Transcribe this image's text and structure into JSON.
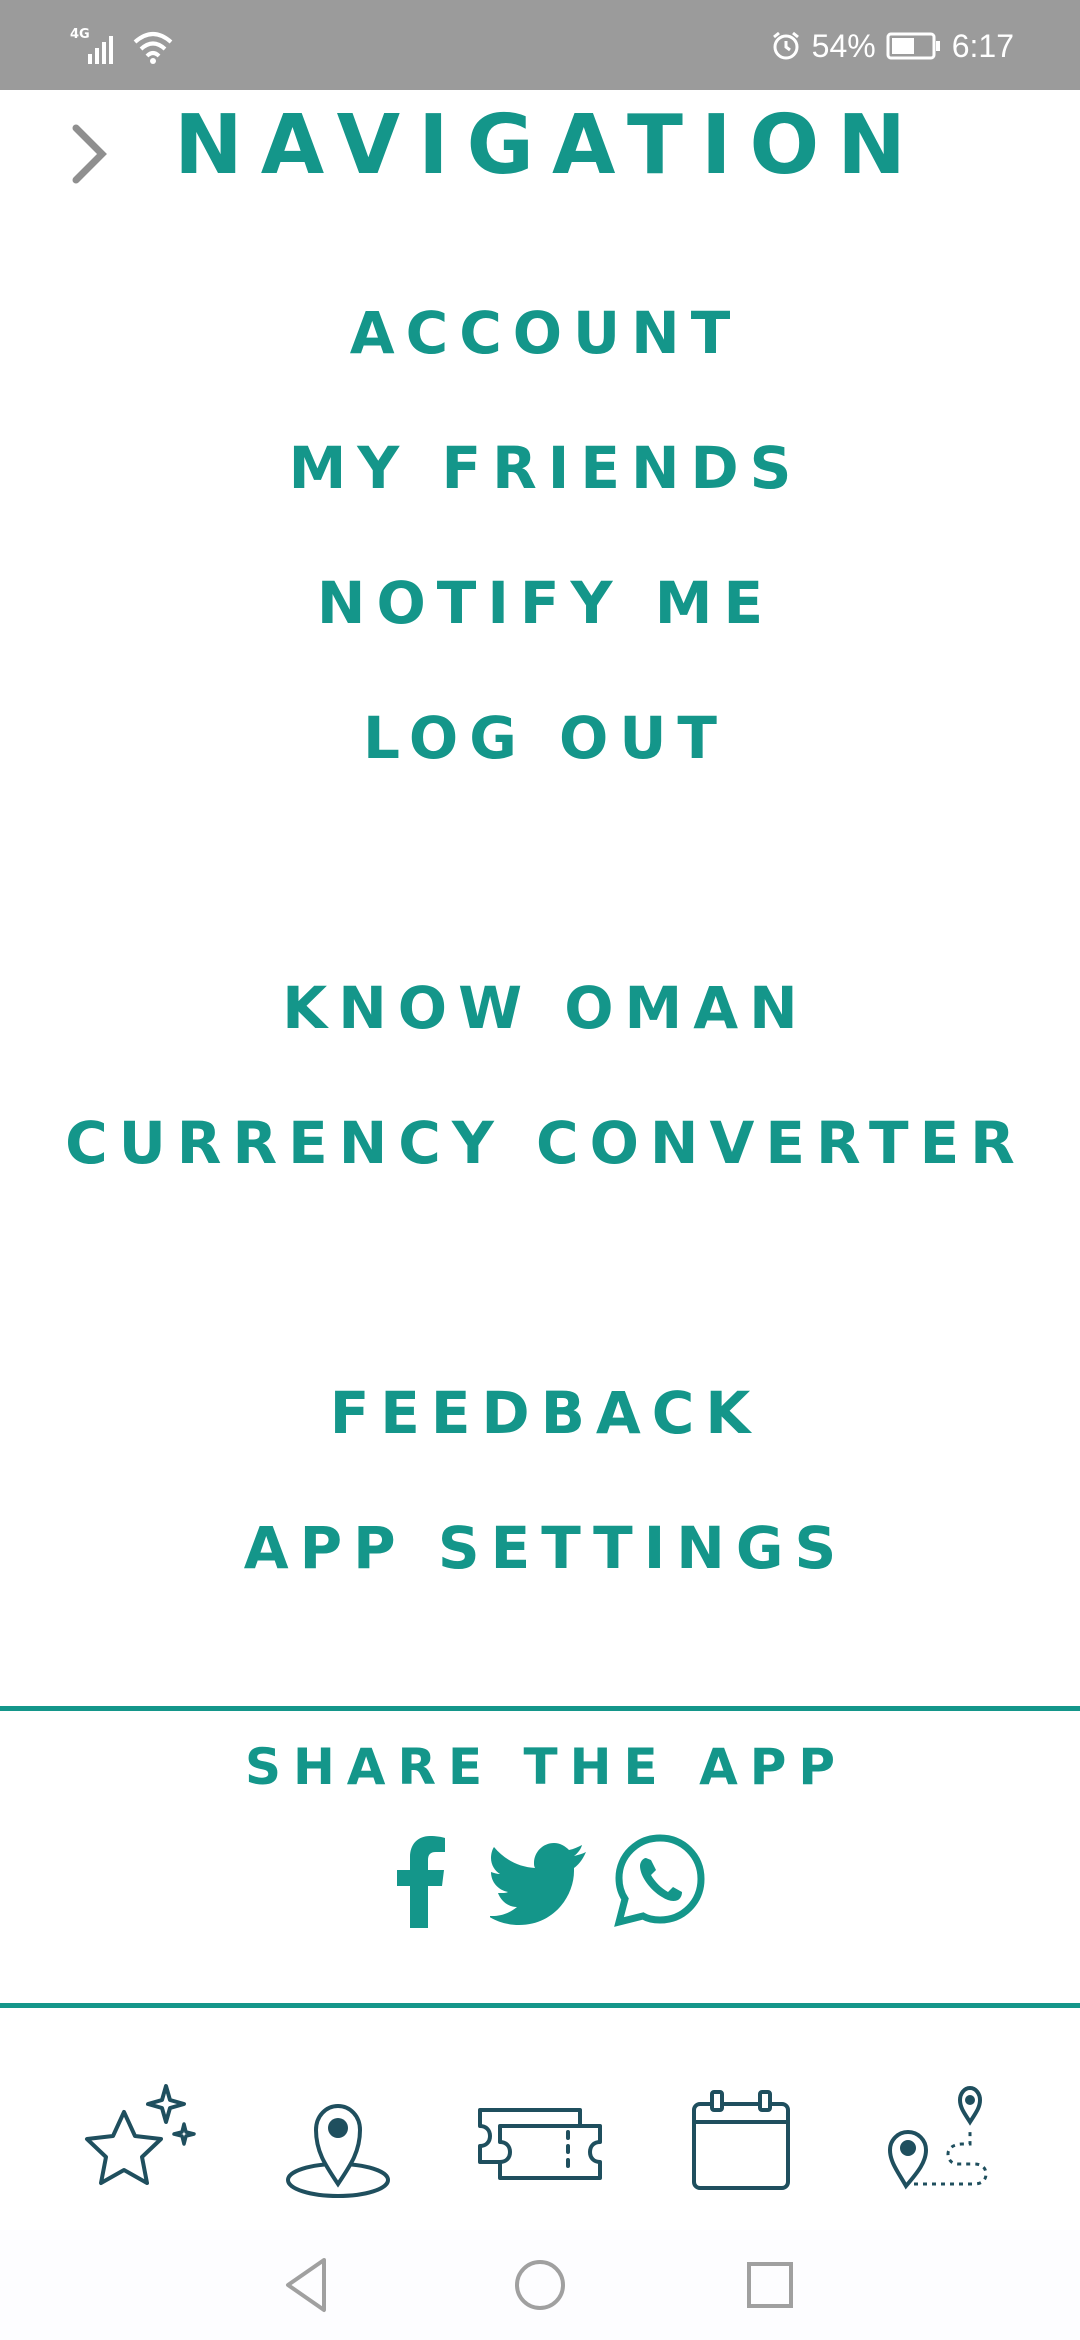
{
  "status_bar": {
    "network": "4G",
    "battery": "54%",
    "time": "6:17"
  },
  "header": {
    "title": "NAVIGATION"
  },
  "menu": {
    "account": "ACCOUNT",
    "my_friends": "MY FRIENDS",
    "notify_me": "NOTIFY ME",
    "log_out": "LOG OUT",
    "know_oman": "KNOW OMAN",
    "currency_converter": "CURRENCY CONVERTER",
    "feedback": "FEEDBACK",
    "app_settings": "APP SETTINGS"
  },
  "share": {
    "title": "SHARE THE APP",
    "icons": [
      "facebook-icon",
      "twitter-icon",
      "whatsapp-icon"
    ]
  },
  "tabbar": {
    "icons": [
      "sparkle-star-icon",
      "location-pin-icon",
      "tickets-icon",
      "calendar-icon",
      "route-icon"
    ]
  },
  "colors": {
    "accent": "#14968a",
    "icon_dark": "#1f4f5e",
    "status_bar": "#9b9b9b"
  }
}
